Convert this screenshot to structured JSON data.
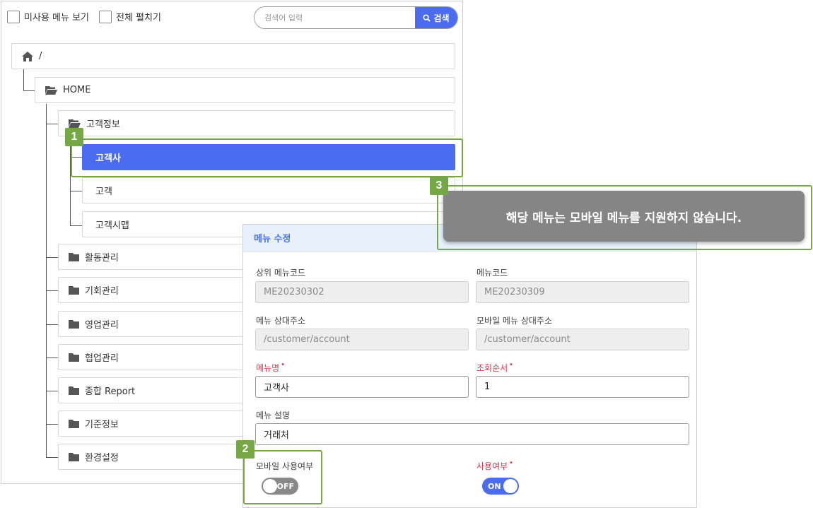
{
  "toolbar": {
    "show_unused_label": "미사용 메뉴 보기",
    "expand_all_label": "전체 펼치기",
    "search_placeholder": "검색어 입력",
    "search_button_label": "검색"
  },
  "tree": {
    "root_label": "/",
    "home_label": "HOME",
    "customer_info_label": "고객정보",
    "children": [
      "고객사",
      "고객",
      "고객시맵"
    ],
    "folders": [
      "활동관리",
      "기회관리",
      "영업관리",
      "협업관리",
      "종합 Report",
      "기준정보",
      "환경설정"
    ]
  },
  "edit": {
    "title": "메뉴 수정",
    "parent_code_label": "상위 메뉴코드",
    "parent_code_value": "ME20230302",
    "menu_code_label": "메뉴코드",
    "menu_code_value": "ME20230309",
    "menu_path_label": "메뉴 상대주소",
    "menu_path_value": "/customer/account",
    "mobile_path_label": "모바일 메뉴 상대주소",
    "mobile_path_value": "/customer/account",
    "menu_name_label": "메뉴명",
    "menu_name_value": "고객사",
    "order_label": "조회순서",
    "order_value": "1",
    "desc_label": "메뉴 설명",
    "desc_value": "거래처",
    "mobile_use_label": "모바일 사용여부",
    "mobile_use_state": "OFF",
    "use_label": "사용여부",
    "use_state": "ON"
  },
  "callouts": [
    "1",
    "2",
    "3"
  ],
  "toast": {
    "message": "해당 메뉴는 모바일 메뉴를 지원하지 않습니다."
  },
  "colors": {
    "accent": "#4b6cf1",
    "callout": "#76a745",
    "required": "#d9304a",
    "toast_bg": "#858585"
  }
}
